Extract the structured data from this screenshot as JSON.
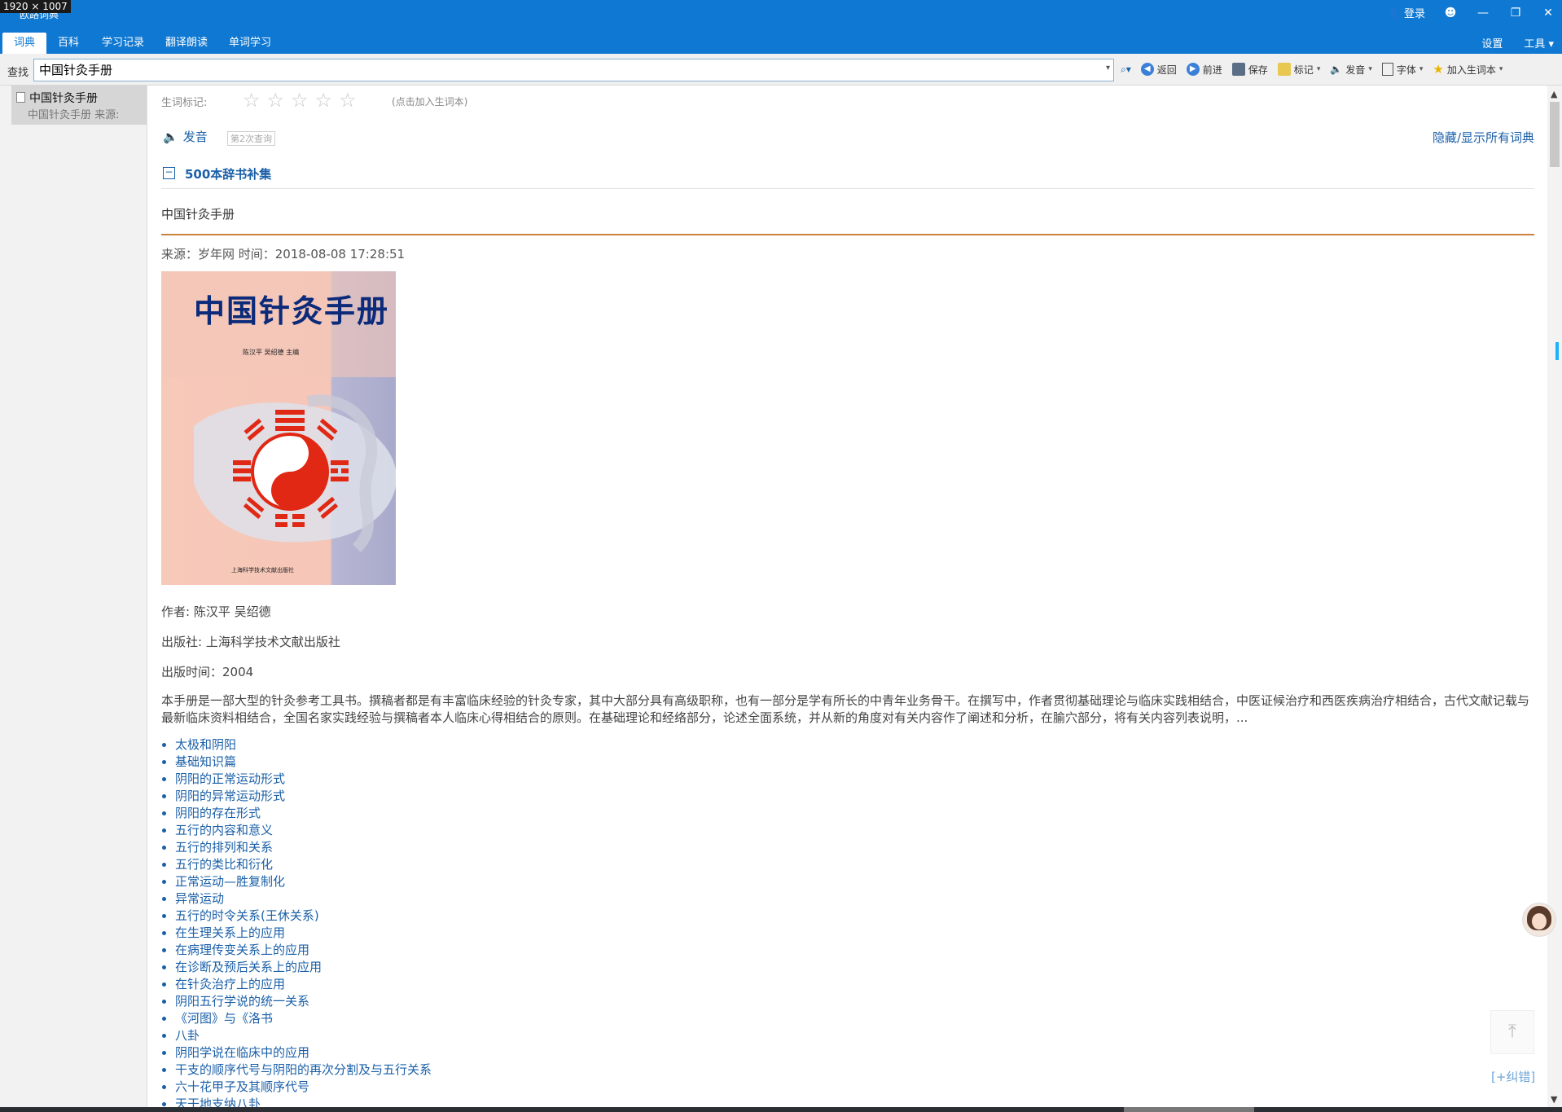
{
  "window": {
    "dim_badge": "1920 × 1007",
    "title": "欧路词典",
    "login": "登录",
    "controls": {
      "theme": "☻",
      "minimize": "—",
      "restore": "❐",
      "close": "✕"
    }
  },
  "menubar": {
    "tabs": [
      {
        "label": "词典",
        "active": true
      },
      {
        "label": "百科",
        "active": false
      },
      {
        "label": "学习记录",
        "active": false
      },
      {
        "label": "翻译朗读",
        "active": false
      },
      {
        "label": "单词学习",
        "active": false
      }
    ],
    "right": [
      {
        "label": "设置"
      },
      {
        "label": "工具 ▾"
      }
    ]
  },
  "search": {
    "label": "查找",
    "value": "中国针灸手册",
    "dropdown": "▾"
  },
  "toolbar": {
    "search_icon": "⌕▾",
    "back": "返回",
    "forward": "前进",
    "save": "保存",
    "mark": "标记",
    "speak": "发音",
    "font": "字体",
    "add_vocab": "加入生词本"
  },
  "sidebar": {
    "items": [
      {
        "title": "中国针灸手册",
        "sub": "中国针灸手册    来源:"
      }
    ]
  },
  "entry": {
    "rating_label": "生词标记:",
    "stars": [
      "☆",
      "☆",
      "☆",
      "☆",
      "☆"
    ],
    "rating_hint": "(点击加入生词本)",
    "pronounce": "发音",
    "query_count": "第2次查询",
    "toggle_all": "隐藏/显示所有词典",
    "section_name": "500本辞书补集",
    "headword": "中国针灸手册",
    "meta": "来源：岁年网 时间：2018-08-08 17:28:51",
    "cover": {
      "title": "中国针灸手册",
      "authors": "陈汉平  吴绍德  主编",
      "publisher": "上海科学技术文献出版社"
    },
    "author": "作者:  陈汉平 吴绍德",
    "publisher": "出版社:  上海科学技术文献出版社",
    "pub_time": "出版时间：2004",
    "summary": "本手册是一部大型的针灸参考工具书。撰稿者都是有丰富临床经验的针灸专家，其中大部分具有高级职称，也有一部分是学有所长的中青年业务骨干。在撰写中，作者贯彻基础理论与临床实践相结合，中医证候治疗和西医疾病治疗相结合，古代文献记载与最新临床资料相结合，全国名家实践经验与撰稿者本人临床心得相结合的原则。在基础理论和经络部分，论述全面系统，并从新的角度对有关内容作了阐述和分析，在腧穴部分，将有关内容列表说明，...",
    "toc": [
      "太极和阴阳",
      "基础知识篇",
      "阴阳的正常运动形式",
      "阴阳的异常运动形式",
      "阴阳的存在形式",
      "五行的内容和意义",
      "五行的排列和关系",
      "五行的类比和衍化",
      "正常运动—胜复制化",
      "异常运动",
      "五行的时令关系(王休关系)",
      "在生理关系上的应用",
      "在病理传变关系上的应用",
      "在诊断及预后关系上的应用",
      "在针灸治疗上的应用",
      "阴阳五行学说的统一关系",
      "《河图》与《洛书",
      "八卦",
      "阴阳学说在临床中的应用",
      "干支的顺序代号与阴阳的再次分割及与五行关系",
      "六十花甲子及其顺序代号",
      "天干地支纳八卦"
    ]
  },
  "footer": {
    "to_top": "⤒",
    "correct": "[+纠错]"
  },
  "colors": {
    "brand": "#0f78d2",
    "link": "#1a5fa8",
    "divider": "#c9833c"
  }
}
